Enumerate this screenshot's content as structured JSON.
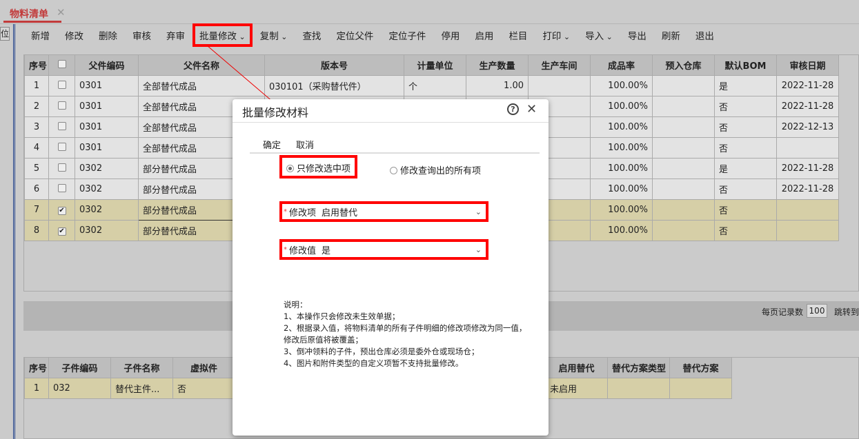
{
  "tab": {
    "title": "物料清单",
    "close": "✕"
  },
  "left_button": "位",
  "toolbar": [
    {
      "label": "新增"
    },
    {
      "label": "修改"
    },
    {
      "label": "删除"
    },
    {
      "label": "审核"
    },
    {
      "label": "弃审"
    },
    {
      "label": "批量修改",
      "dropdown": true
    },
    {
      "label": "复制",
      "dropdown": true
    },
    {
      "label": "查找"
    },
    {
      "label": "定位父件"
    },
    {
      "label": "定位子件"
    },
    {
      "label": "停用"
    },
    {
      "label": "启用"
    },
    {
      "label": "栏目"
    },
    {
      "label": "打印",
      "dropdown": true
    },
    {
      "label": "导入",
      "dropdown": true
    },
    {
      "label": "导出"
    },
    {
      "label": "刷新"
    },
    {
      "label": "退出"
    }
  ],
  "main_grid": {
    "headers": [
      "序号",
      "",
      "父件编码",
      "父件名称",
      "版本号",
      "计量单位",
      "生产数量",
      "生产车间",
      "成品率",
      "预入仓库",
      "默认BOM",
      "审核日期"
    ],
    "rows": [
      [
        "1",
        "0301",
        "全部替代成品",
        "030101（采购替代件）",
        "个",
        "1.00",
        "",
        "100.00%",
        "",
        "是",
        "2022-11-28"
      ],
      [
        "2",
        "0301",
        "全部替代成品",
        "",
        "",
        "",
        "",
        "100.00%",
        "",
        "否",
        "2022-11-28"
      ],
      [
        "3",
        "0301",
        "全部替代成品",
        "",
        "",
        "",
        "",
        "100.00%",
        "",
        "否",
        "2022-12-13"
      ],
      [
        "4",
        "0301",
        "全部替代成品",
        "",
        "",
        "",
        "",
        "100.00%",
        "",
        "否",
        ""
      ],
      [
        "5",
        "0302",
        "部分替代成品",
        "",
        "",
        "",
        "",
        "100.00%",
        "",
        "是",
        "2022-11-28"
      ],
      [
        "6",
        "0302",
        "部分替代成品",
        "",
        "",
        "",
        "",
        "100.00%",
        "",
        "否",
        "2022-11-28"
      ],
      [
        "7",
        "0302",
        "部分替代成品",
        "",
        "",
        "",
        "",
        "100.00%",
        "",
        "否",
        ""
      ],
      [
        "8",
        "0302",
        "部分替代成品",
        "",
        "",
        "",
        "",
        "100.00%",
        "",
        "否",
        ""
      ]
    ],
    "checked": [
      false,
      false,
      false,
      false,
      false,
      false,
      true,
      true
    ]
  },
  "pager": {
    "page_size_label": "每页记录数",
    "page_size": "100",
    "jump_label": "跳转到"
  },
  "sub_grid": {
    "headers": [
      "序号",
      "子件编码",
      "子件名称",
      "虚拟件",
      "启用替代",
      "替代方案类型",
      "替代方案"
    ],
    "rows": [
      [
        "1",
        "032",
        "替代主件...",
        "否",
        "未启用",
        "",
        ""
      ]
    ]
  },
  "dialog": {
    "title": "批量修改材料",
    "help": "?",
    "close": "✕",
    "confirm": "确定",
    "cancel": "取消",
    "radio_selected": "只修改选中项",
    "radio_all": "修改查询出的所有项",
    "field1_label": "修改项",
    "field1_value": "启用替代",
    "field2_label": "修改值",
    "field2_value": "是",
    "notes": [
      "说明：",
      "1、本操作只会修改未生效单据；",
      "2、根据录入值，将物料清单的所有子件明细的修改项修改为同一值，",
      "修改后原值将被覆盖；",
      "3、倒冲领料的子件，预出仓库必须是委外仓或现场仓；",
      "4、图片和附件类型的自定义项暂不支持批量修改。"
    ]
  }
}
